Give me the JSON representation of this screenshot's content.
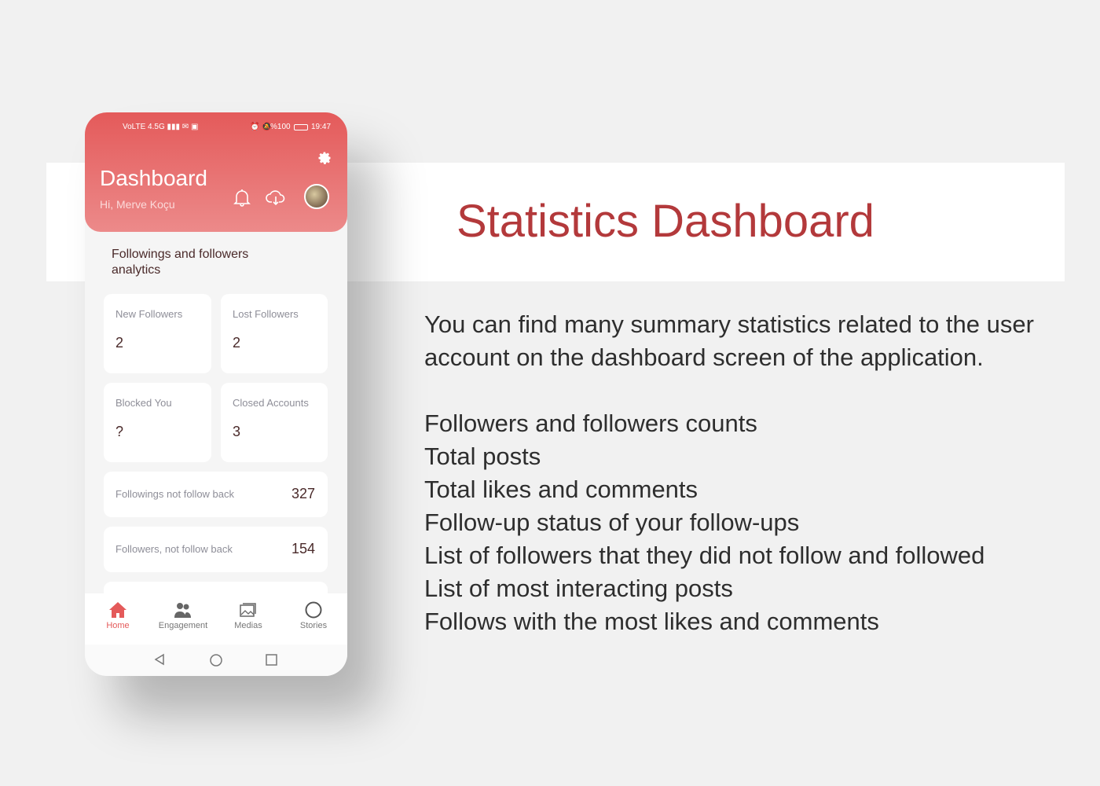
{
  "slide": {
    "heading": "Statistics Dashboard",
    "description": "You can find many summary statistics related to the user account on the dashboard screen of the application.",
    "features": [
      "Followers and followers counts",
      "Total posts",
      "Total likes and comments",
      "Follow-up status of your follow-ups",
      "List of followers that they did not follow and followed",
      "List of most interacting posts",
      "Follows with the most likes and comments"
    ]
  },
  "phone": {
    "status": {
      "left": "VoLTE 4.5G ▮▮▮ ✉ ▣",
      "battery": "%100",
      "time": "19:47"
    },
    "header": {
      "title": "Dashboard",
      "greeting": "Hi, Merve Koçu"
    },
    "section_title": "Followings and followers analytics",
    "cards": [
      {
        "label": "New Followers",
        "value": "2"
      },
      {
        "label": "Lost Followers",
        "value": "2"
      },
      {
        "label": "Blocked You",
        "value": "?"
      },
      {
        "label": "Closed Accounts",
        "value": "3"
      }
    ],
    "rows": [
      {
        "label": "Followings not follow back",
        "value": "327"
      },
      {
        "label": "Followers, not follow back",
        "value": "154"
      }
    ],
    "nav": [
      {
        "label": "Home",
        "active": true
      },
      {
        "label": "Engagement"
      },
      {
        "label": "Medias"
      },
      {
        "label": "Stories"
      }
    ]
  },
  "colors": {
    "accent": "#e45a5a",
    "heading": "#b3393b"
  }
}
